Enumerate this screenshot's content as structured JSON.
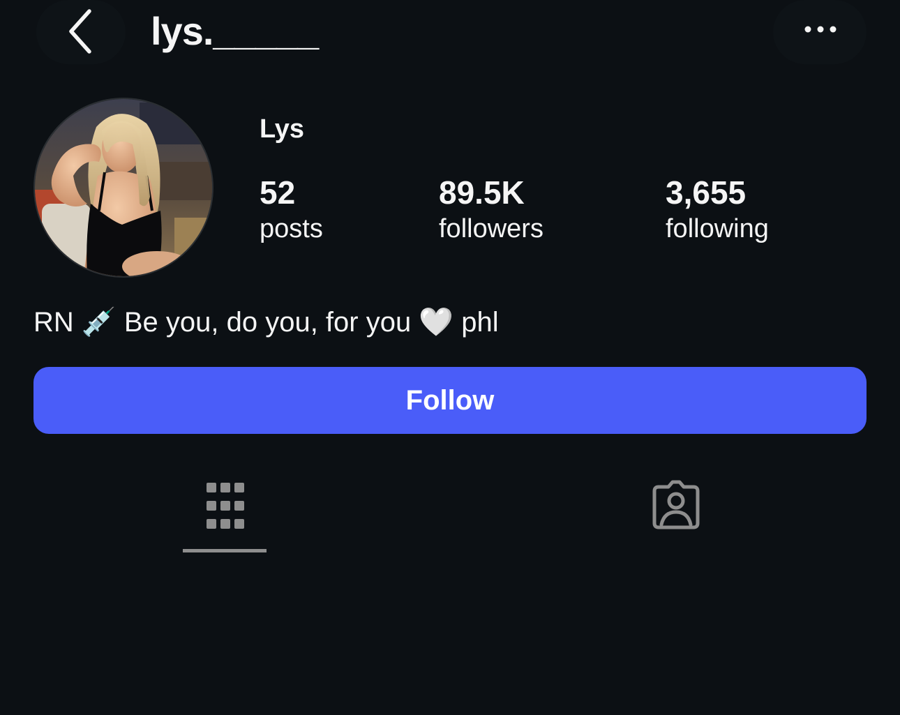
{
  "header": {
    "username": "lys._____",
    "back_icon": "chevron-left-icon",
    "more_icon": "ellipsis-icon"
  },
  "profile": {
    "display_name": "Lys",
    "avatar_icon": "profile-photo"
  },
  "stats": [
    {
      "value": "52",
      "label": "posts"
    },
    {
      "value": "89.5K",
      "label": "followers"
    },
    {
      "value": "3,655",
      "label": "following"
    }
  ],
  "bio": {
    "prefix": "RN",
    "syringe": "💉",
    "text": "Be you, do you, for you",
    "heart": "🤍",
    "suffix": "phl"
  },
  "actions": {
    "follow_label": "Follow"
  },
  "tabs": [
    {
      "name": "posts-grid",
      "icon": "grid-icon",
      "selected": true
    },
    {
      "name": "tagged",
      "icon": "tagged-person-icon",
      "selected": false
    }
  ],
  "colors": {
    "background": "#0c1014",
    "follow_button": "#4a5df9",
    "text": "#f5f5f5",
    "icon_muted": "#8e8e8e"
  }
}
